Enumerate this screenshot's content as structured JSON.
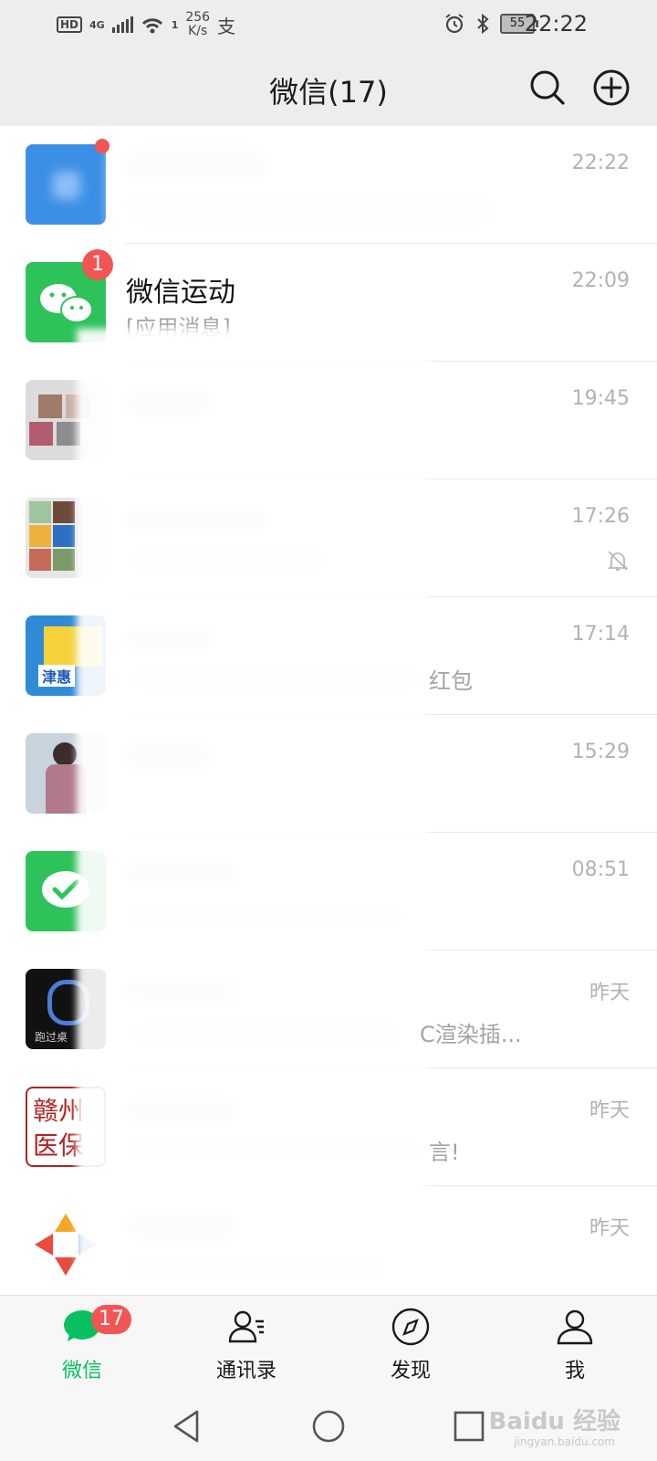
{
  "status_bar": {
    "hd": "HD",
    "network": "4G",
    "wifi_suffix": "1",
    "speed_value": "256",
    "speed_unit": "K/s",
    "battery": "55",
    "time": "22:22"
  },
  "header": {
    "title": "微信(17)",
    "search_icon": "search-icon",
    "add_icon": "plus-circle-icon"
  },
  "chats": [
    {
      "name": "",
      "preview": "",
      "time": "22:22",
      "badge": "",
      "dot": true,
      "avatar_color": "#3c8fe6",
      "blurred": true
    },
    {
      "name": "微信运动",
      "preview": "[应用消息]",
      "time": "22:09",
      "badge": "1",
      "dot": false,
      "avatar_color": "#2ec25b",
      "blurred": false
    },
    {
      "name": "",
      "preview": "",
      "time": "19:45",
      "badge": "",
      "dot": false,
      "avatar_color": "#d9d9d9",
      "blurred": true
    },
    {
      "name": "",
      "preview": "",
      "time": "17:26",
      "badge": "",
      "dot": false,
      "avatar_color": "#c7c7c7",
      "blurred": true,
      "muted": true
    },
    {
      "name": "",
      "preview": "红包",
      "time": "17:14",
      "badge": "",
      "dot": false,
      "avatar_color": "#2f8bd6",
      "blurred": true,
      "avatar_text": "津惠"
    },
    {
      "name": "",
      "preview": "",
      "time": "15:29",
      "badge": "",
      "dot": false,
      "avatar_color": "#b7c3d1",
      "blurred": true
    },
    {
      "name": "",
      "preview": "",
      "time": "08:51",
      "badge": "",
      "dot": false,
      "avatar_color": "#2ec25b",
      "blurred": true
    },
    {
      "name": "",
      "preview": "C渲染插...",
      "time": "昨天",
      "badge": "",
      "dot": false,
      "avatar_color": "#111111",
      "blurred": true,
      "avatar_text": "跑过桌"
    },
    {
      "name": "",
      "preview": "言!",
      "time": "昨天",
      "badge": "",
      "dot": false,
      "avatar_color": "#ffffff",
      "blurred": true,
      "avatar_text": "赣州 医保"
    },
    {
      "name": "",
      "preview": "",
      "time": "昨天",
      "badge": "",
      "dot": false,
      "avatar_color": "#f5a623",
      "blurred": true
    }
  ],
  "tabs": [
    {
      "label": "微信",
      "icon": "chat-bubble-icon",
      "badge": "17",
      "active": true
    },
    {
      "label": "通讯录",
      "icon": "contacts-icon",
      "badge": "",
      "active": false
    },
    {
      "label": "发现",
      "icon": "compass-icon",
      "badge": "",
      "active": false
    },
    {
      "label": "我",
      "icon": "person-icon",
      "badge": "",
      "active": false
    }
  ],
  "nav": {
    "back": "back-triangle-icon",
    "home": "home-circle-icon",
    "recents": "recents-square-icon"
  },
  "watermark": {
    "main": "Baidu 经验",
    "sub": "jingyan.baidu.com"
  },
  "colors": {
    "accent": "#07c160",
    "badge": "#f35454",
    "background": "#ededed"
  }
}
